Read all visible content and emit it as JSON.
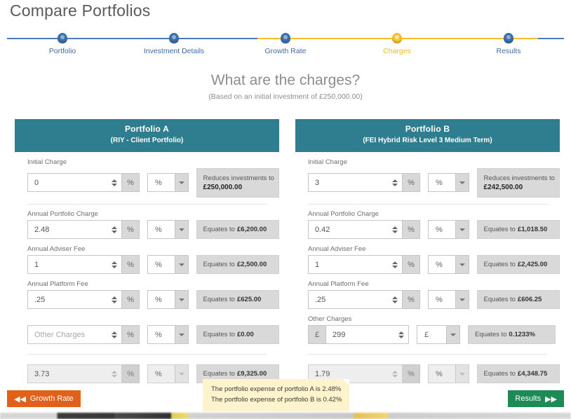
{
  "page": {
    "title": "Compare Portfolios",
    "question": "What are the charges?",
    "question_sub": "(Based on an initial investment of £250,000.00)"
  },
  "tracker": {
    "steps": [
      {
        "label": "Portfolio",
        "state": "done"
      },
      {
        "label": "Investment Details",
        "state": "done"
      },
      {
        "label": "Growth Rate",
        "state": "done"
      },
      {
        "label": "Charges",
        "state": "active"
      },
      {
        "label": "Results",
        "state": "upcoming"
      }
    ],
    "colors": {
      "line": "#4a7ebb",
      "active": "#f5bf2e",
      "dot": "#3b6ea8"
    }
  },
  "portfolio_a": {
    "title": "Portfolio A",
    "subtitle": "(RIY - Client Portfolio)",
    "initial_charge": {
      "label": "Initial Charge",
      "value": "0",
      "unit_addon": "%",
      "unit_select": "%",
      "result_label": "Reduces investments to",
      "result_value": "£250,000.00"
    },
    "rows": [
      {
        "label": "Annual Portfolio Charge",
        "value": "2.48",
        "unit_addon": "%",
        "unit_select": "%",
        "result_label": "Equates to",
        "result_value": "£6,200.00"
      },
      {
        "label": "Annual Adviser Fee",
        "value": "1",
        "unit_addon": "%",
        "unit_select": "%",
        "result_label": "Equates to",
        "result_value": "£2,500.00"
      },
      {
        "label": "Annual Platform Fee",
        "value": ".25",
        "unit_addon": "%",
        "unit_select": "%",
        "result_label": "Equates to",
        "result_value": "£625.00"
      }
    ],
    "other_charges": {
      "label": "",
      "placeholder": "Other Charges",
      "value": "",
      "unit_addon": "%",
      "unit_select": "%",
      "result_label": "Equates to",
      "result_value": "£0.00"
    },
    "total": {
      "value": "3.73",
      "unit_addon": "%",
      "unit_select": "%",
      "result_label": "Equates to",
      "result_value": "£9,325.00"
    }
  },
  "portfolio_b": {
    "title": "Portfolio B",
    "subtitle": "(FEI Hybrid Risk Level 3 Medium Term)",
    "initial_charge": {
      "label": "Initial Charge",
      "value": "3",
      "unit_addon": "%",
      "unit_select": "%",
      "result_label": "Reduces investments to",
      "result_value": "£242,500.00"
    },
    "rows": [
      {
        "label": "Annual Portfolio Charge",
        "value": "0.42",
        "unit_addon": "%",
        "unit_select": "%",
        "result_label": "Equates to",
        "result_value": "£1,018.50"
      },
      {
        "label": "Annual Adviser Fee",
        "value": "1",
        "unit_addon": "%",
        "unit_select": "%",
        "result_label": "Equates to",
        "result_value": "£2,425.00"
      },
      {
        "label": "Annual Platform Fee",
        "value": ".25",
        "unit_addon": "%",
        "unit_select": "%",
        "result_label": "Equates to",
        "result_value": "£606.25"
      }
    ],
    "other_charges": {
      "label": "Other Charges",
      "placeholder": "Other Charges",
      "value": "299",
      "unit_addon": "£",
      "unit_select": "£",
      "result_label": "Equates to",
      "result_value": "0.1233%"
    },
    "total": {
      "value": "1.79",
      "unit_addon": "%",
      "unit_select": "%",
      "result_label": "Equates to",
      "result_value": "£4,348.75"
    }
  },
  "tooltip": {
    "line1": "The portfolio expense of portfolio A is 2.48%",
    "line2": "The portfolio expense of portfolio B is 0.42%"
  },
  "footer": {
    "back_label": "Growth Rate",
    "back_glyph": "◀◀",
    "next_label": "Results",
    "next_glyph": "▶▶",
    "back_color": "#e1601a",
    "next_color": "#1e8a56"
  },
  "theme": {
    "header_teal": "#2e7e8f"
  }
}
